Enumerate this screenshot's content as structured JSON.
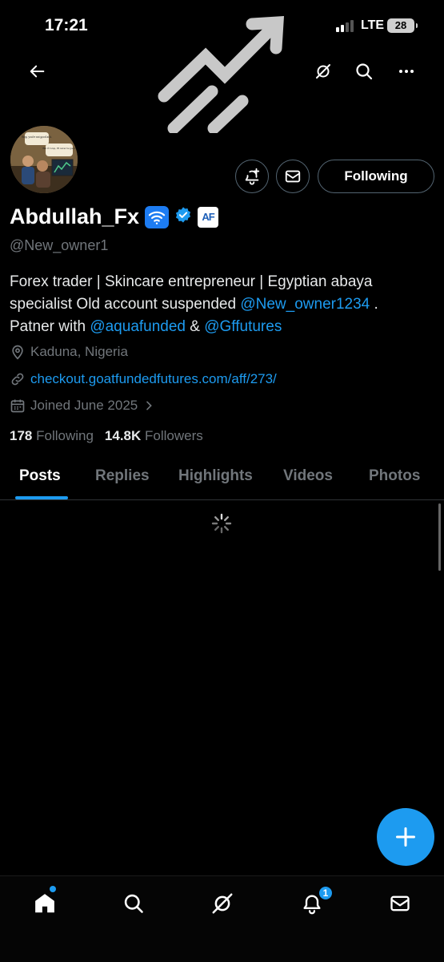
{
  "status_bar": {
    "time": "17:21",
    "network": "LTE",
    "battery": "28"
  },
  "header_icons": [
    "back-arrow-icon",
    "grok-icon",
    "search-icon",
    "more-icon"
  ],
  "profile": {
    "display_name": "Abdullah_Fx",
    "badge_text": "AF",
    "handle": "@New_owner1",
    "avatar_caption_1": "Stop, you're not good at it.",
    "avatar_caption_2": "But if I stop, I'll never be good.",
    "bio": {
      "line1": "Forex trader | Skincare entrepreneur | Egyptian abaya",
      "line2_prefix": "specialist Old account suspended ",
      "mention_1": "@New_owner1234",
      "line2_suffix": " .",
      "line3_prefix": "Patner with ",
      "mention_2": "@aquafunded",
      "amp": " & ",
      "mention_3": "@Gffutures"
    },
    "location": "Kaduna, Nigeria",
    "website": "checkout.goatfundedfutures.com/aff/273/",
    "joined": "Joined June 2025",
    "following_count": "178",
    "following_label": "Following",
    "followers_count": "14.8K",
    "followers_label": "Followers"
  },
  "actions": {
    "follow_label": "Following"
  },
  "tabs": [
    {
      "label": "Posts",
      "active": true
    },
    {
      "label": "Replies",
      "active": false
    },
    {
      "label": "Highlights",
      "active": false
    },
    {
      "label": "Videos",
      "active": false
    },
    {
      "label": "Photos",
      "active": false
    }
  ],
  "bottom_nav": {
    "items": [
      "home-icon",
      "search-icon",
      "grok-icon",
      "notifications-icon",
      "messages-icon"
    ],
    "notification_count": "1"
  },
  "colors": {
    "accent": "#1d9bf0",
    "background": "#000000",
    "muted": "#71767b"
  }
}
